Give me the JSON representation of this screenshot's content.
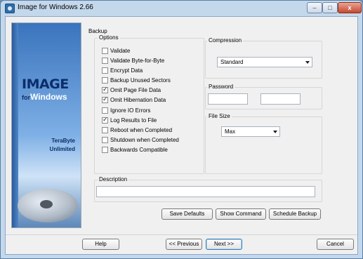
{
  "window": {
    "title": "Image for Windows 2.66"
  },
  "title_buttons": {
    "min": "–",
    "max": "□",
    "close": "x"
  },
  "panel": {
    "logo_main": "IMAGE",
    "logo_for": "for",
    "logo_windows": "Windows",
    "company_line1": "TeraByte",
    "company_line2": "Unlimited"
  },
  "backup": {
    "heading": "Backup",
    "options_label": "Options",
    "options": [
      {
        "label": "Validate",
        "checked": false
      },
      {
        "label": "Validate Byte-for-Byte",
        "checked": false
      },
      {
        "label": "Encrypt Data",
        "checked": false
      },
      {
        "label": "Backup Unused Sectors",
        "checked": false
      },
      {
        "label": "Omit Page File Data",
        "checked": true
      },
      {
        "label": "Omit Hibernation Data",
        "checked": true
      },
      {
        "label": "Ignore IO Errors",
        "checked": false
      },
      {
        "label": "Log Results to File",
        "checked": true
      },
      {
        "label": "Reboot when Completed",
        "checked": false
      },
      {
        "label": "Shutdown when Completed",
        "checked": false
      },
      {
        "label": "Backwards Compatible",
        "checked": false
      }
    ],
    "compression_label": "Compression",
    "compression_value": "Standard",
    "password_label": "Password",
    "password_value": "",
    "password_confirm_value": "",
    "filesize_label": "File Size",
    "filesize_value": "Max",
    "description_label": "Description",
    "description_value": ""
  },
  "actions": {
    "save_defaults": "Save Defaults",
    "show_command": "Show Command",
    "schedule_backup": "Schedule Backup"
  },
  "footer": {
    "help": "Help",
    "previous": "<< Previous",
    "next": "Next >>",
    "cancel": "Cancel"
  }
}
